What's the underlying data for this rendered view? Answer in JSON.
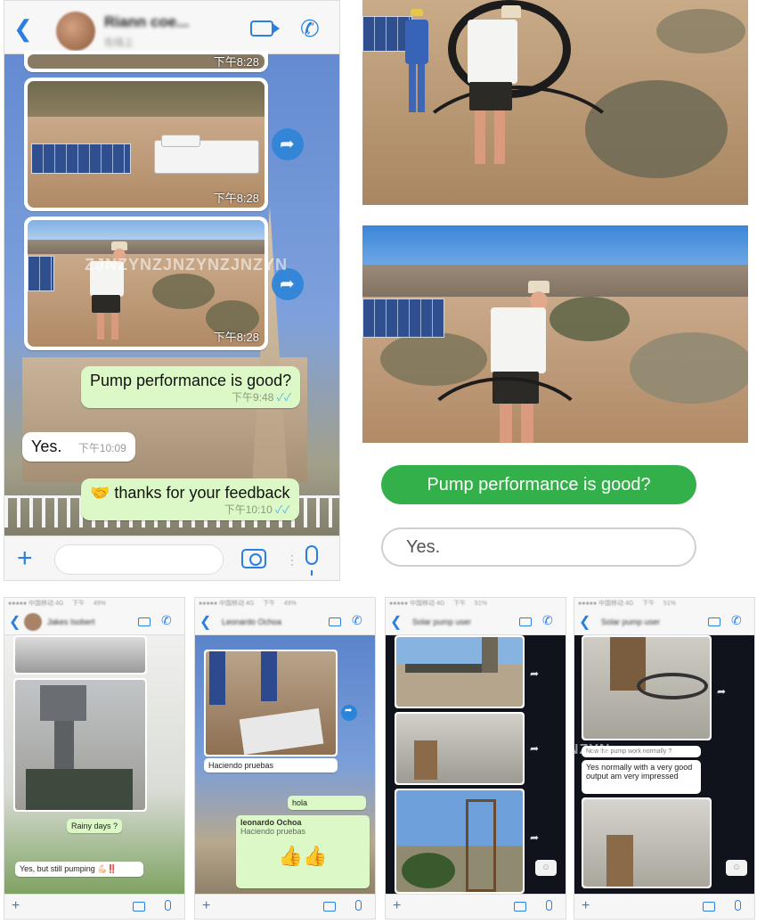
{
  "main_chat": {
    "contact_name": "Riann coe...",
    "contact_status": "在线上",
    "image_times": [
      "下午8:28",
      "下午8:28",
      "下午8:28"
    ],
    "messages": [
      {
        "dir": "out",
        "text": "Pump performance is good?",
        "time": "下午9:48"
      },
      {
        "dir": "in",
        "text": "Yes.",
        "time": "下午10:09"
      },
      {
        "dir": "out",
        "text": "🤝 thanks for your feedback",
        "time": "下午10:10"
      }
    ],
    "watermark": "ZJNZYNZJNZYNZJNZYN"
  },
  "summary": {
    "question": "Pump performance is good?",
    "answer": "Yes."
  },
  "mini_chats": [
    {
      "title": "Jakes Isobert",
      "messages": [
        {
          "dir": "out",
          "text": "Rainy days ?"
        },
        {
          "dir": "in",
          "text": "Yes, but still pumping 💪🏻‼️"
        }
      ]
    },
    {
      "title": "Leonardo Ochoa",
      "messages": [
        {
          "dir": "in",
          "text": "Haciendo pruebas"
        },
        {
          "dir": "out",
          "text": "hola"
        },
        {
          "dir": "out",
          "text": "leonardo Ochoa"
        },
        {
          "dir": "out",
          "text": "Haciendo pruebas"
        },
        {
          "dir": "out",
          "text": "👍👍"
        }
      ]
    },
    {
      "title": "Solar pump user",
      "messages": []
    },
    {
      "title": "Solar pump user",
      "messages": [
        {
          "dir": "in",
          "text": "Now the pump work normally ?"
        },
        {
          "dir": "in",
          "text": "Yes normally with a very good output am very impressed"
        }
      ],
      "watermark": "ZJNZYNZJNZYN"
    }
  ],
  "icons": {
    "accent": "#2a7fe0",
    "bubble_out": "#dcf8c6",
    "pill_green": "#34b04b"
  }
}
